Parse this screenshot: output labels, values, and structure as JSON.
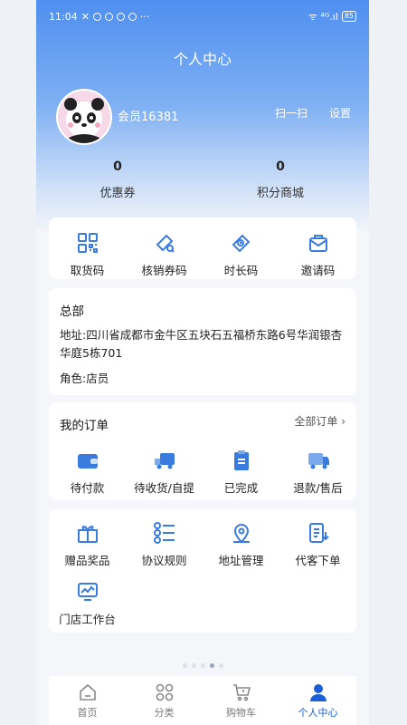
{
  "status_bar": {
    "time": "11:04",
    "dots": "···",
    "signal": "ᯤ ⁴ᴳ.ıl",
    "battery": "85"
  },
  "header": {
    "title": "个人中心"
  },
  "user": {
    "member_name": "会员16381",
    "scan_label": "扫一扫",
    "settings_label": "设置"
  },
  "stats": [
    {
      "value": "0",
      "label": "优惠券"
    },
    {
      "value": "0",
      "label": "积分商城"
    }
  ],
  "codes": [
    {
      "label": "取货码",
      "icon": "grid-qr-icon"
    },
    {
      "label": "核销券码",
      "icon": "coupon-check-icon"
    },
    {
      "label": "时长码",
      "icon": "clock-ticket-icon"
    },
    {
      "label": "邀请码",
      "icon": "envelope-icon"
    }
  ],
  "store": {
    "name": "总部",
    "address": "地址:四川省成都市金牛区五块石五福桥东路6号华润银杏华庭5栋701",
    "role": "角色:店员"
  },
  "orders": {
    "title": "我的订单",
    "all_label": "全部订单",
    "items": [
      {
        "label": "待付款",
        "icon": "wallet-icon"
      },
      {
        "label": "待收货/自提",
        "icon": "truck-icon"
      },
      {
        "label": "已完成",
        "icon": "clipboard-icon"
      },
      {
        "label": "退款/售后",
        "icon": "return-truck-icon"
      }
    ]
  },
  "services": {
    "items": [
      {
        "label": "赠品奖品",
        "icon": "gift-icon"
      },
      {
        "label": "协议规则",
        "icon": "list-icon"
      },
      {
        "label": "地址管理",
        "icon": "location-icon"
      },
      {
        "label": "代客下单",
        "icon": "order-form-icon"
      },
      {
        "label": "门店工作台",
        "icon": "dashboard-icon"
      }
    ]
  },
  "tabbar": [
    {
      "label": "首页",
      "icon": "home-icon"
    },
    {
      "label": "分类",
      "icon": "category-icon"
    },
    {
      "label": "购物车",
      "icon": "cart-icon"
    },
    {
      "label": "个人中心",
      "icon": "user-icon",
      "active": true
    }
  ],
  "colors": {
    "accent": "#1a5fd8",
    "icon_blue": "#3a7be0",
    "header_blue": "#4f8ff0"
  }
}
